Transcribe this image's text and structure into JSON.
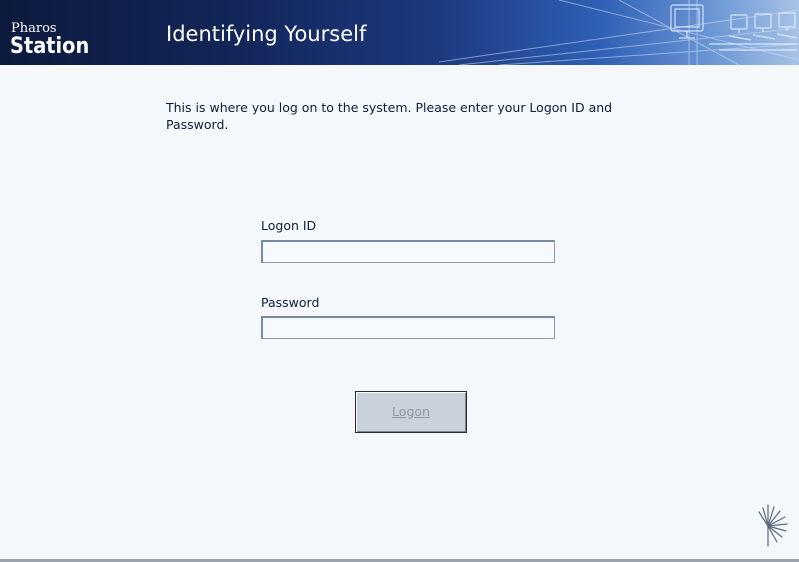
{
  "header": {
    "brand_small": "Pharos",
    "brand_big": "Station",
    "title": "Identifying Yourself"
  },
  "instructions": "This is where you log on to the system.  Please enter your Logon ID and Password.",
  "form": {
    "logon_id_label": "Logon ID",
    "logon_id_value": "",
    "password_label": "Password",
    "password_value": "",
    "logon_button_label": "Logon",
    "logon_button_enabled": false
  },
  "icons": {
    "header_decoration": "computer-network-graphic",
    "corner_logo": "pharos-starburst-icon"
  },
  "colors": {
    "header_dark": "#0c1a3d",
    "header_light": "#a8c3e6",
    "page_background": "#f4f8fb",
    "text": "#0e1e3a",
    "button_face": "#c9d1db",
    "button_text_disabled": "#8f97a4"
  }
}
